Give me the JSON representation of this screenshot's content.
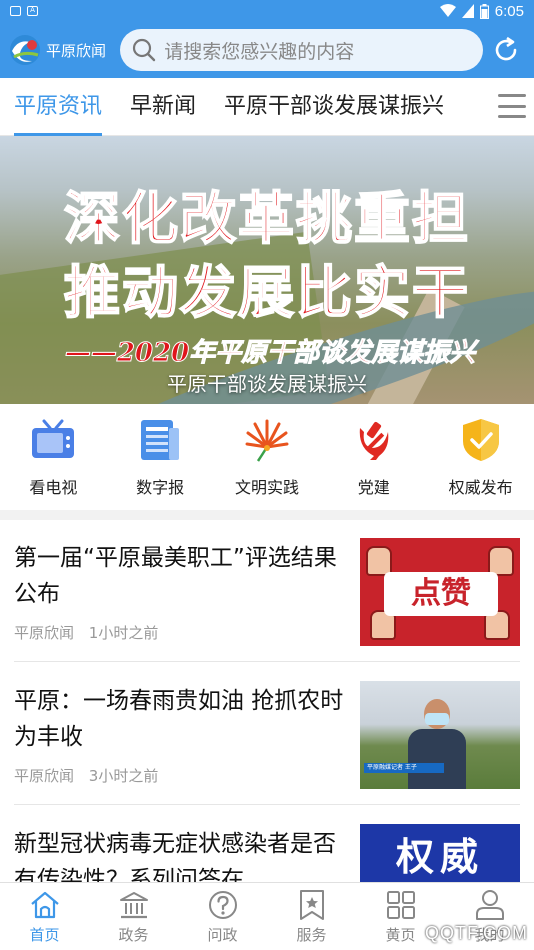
{
  "status_bar": {
    "time": "6:05"
  },
  "header": {
    "logo_text": "平原欣闻",
    "search_placeholder": "请搜索您感兴趣的内容"
  },
  "tabs": [
    {
      "label": "平原资讯",
      "active": true
    },
    {
      "label": "早新闻",
      "active": false
    },
    {
      "label": "平原干部谈发展谋振兴",
      "active": false
    }
  ],
  "banner": {
    "line1": "深化改革挑重担",
    "line2": "推动发展比实干",
    "line3": "——2020年平原干部谈发展谋振兴",
    "caption": "平原干部谈发展谋振兴"
  },
  "quick_links": [
    {
      "label": "看电视",
      "icon": "tv-icon"
    },
    {
      "label": "数字报",
      "icon": "newspaper-icon"
    },
    {
      "label": "文明实践",
      "icon": "flower-icon"
    },
    {
      "label": "党建",
      "icon": "party-emblem-icon"
    },
    {
      "label": "权威发布",
      "icon": "shield-check-icon"
    }
  ],
  "news": [
    {
      "title": "第一届“平原最美职工”评选结果公布",
      "source": "平原欣闻",
      "time": "1小时之前",
      "thumb_text": "点赞"
    },
    {
      "title": "平原：一场春雨贵如油 抢抓农时为丰收",
      "source": "平原欣闻",
      "time": "3小时之前",
      "thumb_text": "平原融媒记者 王子"
    },
    {
      "title": "新型冠状病毒无症状感染者是否有传染性？系列问答在",
      "source": "",
      "time": "",
      "thumb_text": "权威"
    }
  ],
  "bottom_nav": [
    {
      "label": "首页",
      "active": true,
      "icon": "home-icon"
    },
    {
      "label": "政务",
      "active": false,
      "icon": "government-icon"
    },
    {
      "label": "问政",
      "active": false,
      "icon": "question-icon"
    },
    {
      "label": "服务",
      "active": false,
      "icon": "bookmark-icon"
    },
    {
      "label": "黄页",
      "active": false,
      "icon": "grid-icon"
    },
    {
      "label": "我的",
      "active": false,
      "icon": "user-icon"
    }
  ],
  "watermark": "QQTF.COM",
  "colors": {
    "accent": "#3e97e8",
    "inactive": "#888888",
    "banner_red": "#e0151b"
  }
}
